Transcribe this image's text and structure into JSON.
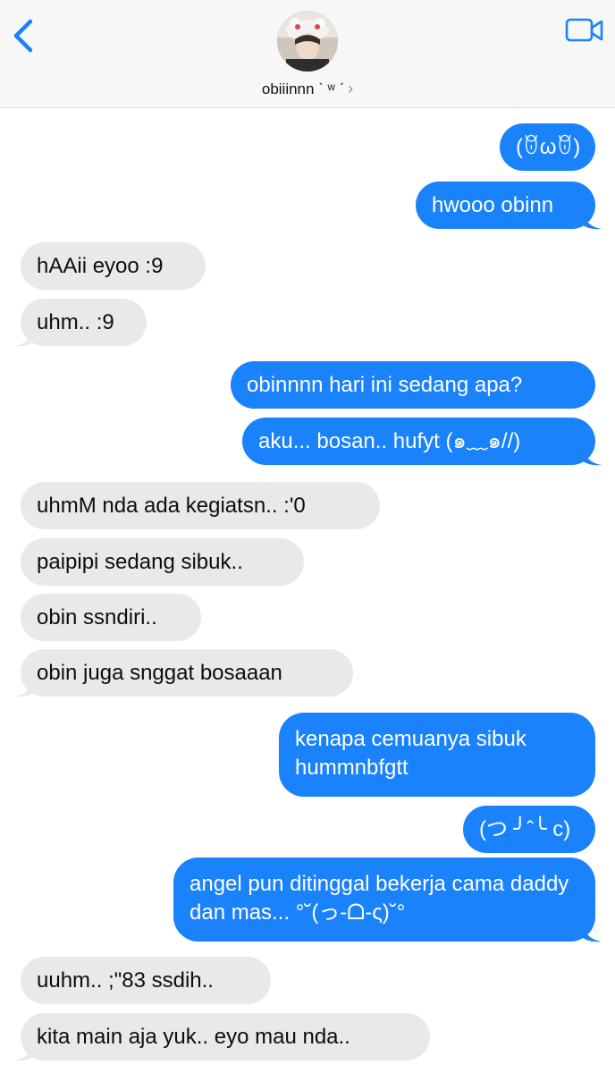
{
  "header": {
    "contact_name": "obiiinnn ˋ ʷ ˊ",
    "chevron": "›",
    "back_icon": "chevron-left-icon",
    "video_icon": "video-camera-icon",
    "accent": "#1a82fb"
  },
  "messages": [
    {
      "side": "sent",
      "text": "(ꆤωꆤ)"
    },
    {
      "side": "sent",
      "text": "hwooo obinn"
    },
    {
      "side": "recv",
      "text": "hAAii eyoo :9"
    },
    {
      "side": "recv",
      "text": "uhm.. :9"
    },
    {
      "side": "sent",
      "text": "obinnnn hari ini sedang apa?"
    },
    {
      "side": "sent",
      "text": "aku... bosan.. hufyt (๑﹏๑//)"
    },
    {
      "side": "recv",
      "text": "uhmM nda ada kegiatsn.. :'0"
    },
    {
      "side": "recv",
      "text": "paipipi sedang sibuk.."
    },
    {
      "side": "recv",
      "text": "obin ssndiri.."
    },
    {
      "side": "recv",
      "text": "obin juga snggat bosaaan"
    },
    {
      "side": "sent",
      "text": "kenapa cemuanya sibuk hummnbfgtt"
    },
    {
      "side": "sent",
      "text": "(つ ╯ˆ╰ c)"
    },
    {
      "side": "sent",
      "text": "angel pun ditinggal bekerja cama daddy dan mas... °˘(っ-ᗝ-ς)˘°"
    },
    {
      "side": "recv",
      "text": "uuhm.. ;\"83 ssdih.."
    },
    {
      "side": "recv",
      "text": "kita main aja yuk.. eyo mau nda.."
    }
  ],
  "colors": {
    "sent_bubble": "#1a82fb",
    "recv_bubble": "#e9e9eb",
    "header_bg": "#f7f7f7"
  }
}
